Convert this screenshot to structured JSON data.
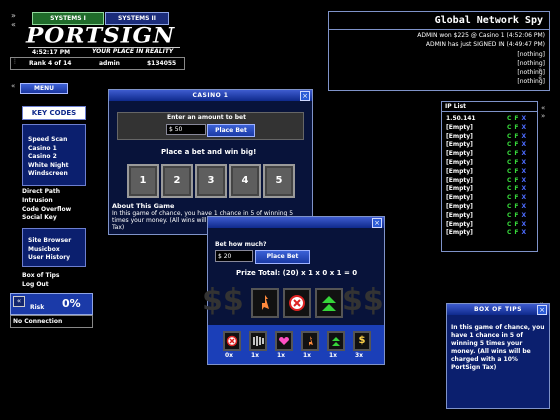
{
  "header": {
    "tabs": [
      "SYSTEMS I",
      "SYSTEMS II"
    ],
    "logo": "PORTSIGN",
    "time": "4:52:17 PM",
    "tagline": "YOUR PLACE IN REALITY",
    "rank": "Rank 4 of 14",
    "user": "admin",
    "money": "$134055"
  },
  "menu": {
    "label": "MENU",
    "keycodes_title": "KEY CODES",
    "group1": [
      "Speed Scan",
      "Casino 1",
      "Casino 2",
      "White Night",
      "Windscreen"
    ],
    "group2": [
      "Direct Path",
      "Intrusion",
      "Code Overflow",
      "Social Key"
    ],
    "group3": [
      "Site Browser",
      "Musicbox",
      "User History"
    ],
    "group4": [
      "Box of Tips",
      "Log Out"
    ]
  },
  "risk": {
    "label": "Risk",
    "value": "0%",
    "status": "No Connection"
  },
  "network": {
    "title": "Global Network Spy",
    "lines": [
      "ADMIN won $225 @ Casino 1 (4:52:06 PM)",
      "ADMIN has just SIGNED IN (4:49:47 PM)",
      "[nothing]",
      "[nothing]",
      "[nothing]",
      "[nothing]"
    ]
  },
  "ip_list": {
    "title": "IP List",
    "entries": [
      "1.50.141",
      "[Empty]",
      "[Empty]",
      "[Empty]",
      "[Empty]",
      "[Empty]",
      "[Empty]",
      "[Empty]",
      "[Empty]",
      "[Empty]",
      "[Empty]",
      "[Empty]",
      "[Empty]",
      "[Empty]"
    ],
    "actions": "C F X"
  },
  "casino1": {
    "title": "CASINO 1",
    "enter_label": "Enter an amount to bet",
    "amount": "$ 50",
    "place_bet": "Place Bet",
    "prompt": "Place a bet and win big!",
    "numbers": [
      "1",
      "2",
      "3",
      "4",
      "5"
    ],
    "about_title": "About This Game",
    "about_text": "In this game of chance, you have 1 chance in 5 of winning 5 times your money. (All wins will be charged with a 10% PortSign Tax)"
  },
  "casino2": {
    "bet_label": "Bet how much?",
    "amount": "$ 20",
    "place_bet": "Place Bet",
    "prize": "Prize Total: (20) x 1 x 0 x 1 = 0",
    "multipliers": [
      "0x",
      "1x",
      "1x",
      "1x",
      "1x",
      "3x"
    ]
  },
  "tips": {
    "title": "BOX OF TIPS",
    "text": "In this game of chance, you have 1 chance in 5 of winning 5 times your money. (All wins will be charged with a 10% PortSign Tax)"
  },
  "colors": {
    "accent": "#1b3fb8",
    "panel": "#08133a",
    "green": "#36d63a"
  }
}
